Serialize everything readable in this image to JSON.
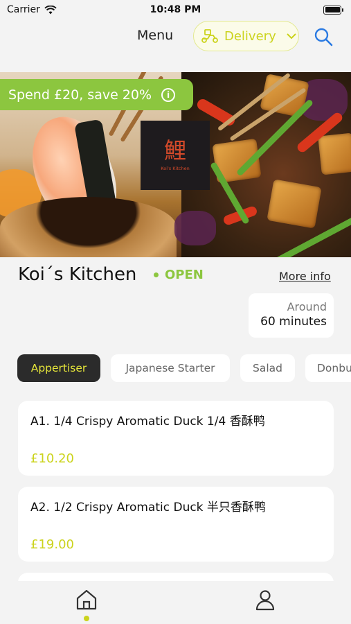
{
  "status_bar": {
    "carrier": "Carrier",
    "time": "10:48 PM"
  },
  "header": {
    "title": "Menu",
    "delivery_label": "Delivery",
    "search_icon": "search-icon"
  },
  "hero": {
    "promo": "Spend £20, save 20%",
    "logo_mark": "鯉",
    "logo_sub": "Koi's Kitchen"
  },
  "restaurant": {
    "name": "Koi´s Kitchen",
    "status": "OPEN",
    "more_info": "More info",
    "time_label": "Around",
    "time_value": "60 minutes"
  },
  "categories": [
    {
      "label": "Appertiser",
      "active": true
    },
    {
      "label": "Japanese Starter",
      "active": false
    },
    {
      "label": "Salad",
      "active": false
    },
    {
      "label": "Donburi",
      "active": false
    }
  ],
  "menu_items": [
    {
      "name": "A1. 1/4 Crispy Aromatic Duck 1/4 香酥鸭",
      "price": "£10.20"
    },
    {
      "name": "A2. 1/2 Crispy Aromatic Duck 半只香酥鸭",
      "price": "£19.00"
    }
  ],
  "bottom_nav": {
    "home_icon": "home-icon",
    "profile_icon": "profile-icon"
  },
  "colors": {
    "accent": "#cbd31c",
    "open": "#8cc63f",
    "promo_bg": "#8cc63f",
    "chip_active_bg": "#2b2b2b"
  }
}
